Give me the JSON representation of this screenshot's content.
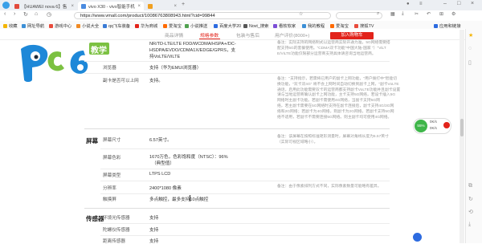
{
  "tabs": [
    {
      "title": "【HUAWEI nova 6】售",
      "active": false,
      "color": "#e24a3b"
    },
    {
      "title": "vivo X30 - vivo智能手机",
      "active": true,
      "color": "#4a8be0"
    },
    {
      "title": "",
      "active": false,
      "color": "#f0a020"
    }
  ],
  "address": {
    "url": "https://www.vmall.com/product/10086763808943.html?cid=99844"
  },
  "bookmarks": [
    {
      "label": "收藏",
      "color": "#f3b400"
    },
    {
      "label": "网址导航",
      "color": "#3c8fd6"
    },
    {
      "label": "游戏中心",
      "color": "#e94b3c"
    },
    {
      "label": "小说大全",
      "color": "#f08a24"
    },
    {
      "label": "qq飞车装备",
      "color": "#3a7bd5"
    },
    {
      "label": "华为商城",
      "color": "#e2231a"
    },
    {
      "label": "爱淘宝",
      "color": "#ff6a00"
    },
    {
      "label": "小说推送",
      "color": "#50a14f"
    },
    {
      "label": "百度大学20",
      "color": "#2d6be0"
    },
    {
      "label": "Novt_搜索",
      "color": "#555555"
    },
    {
      "label": "看软软家",
      "color": "#7b4dd6"
    },
    {
      "label": "我的教程",
      "color": "#3c8fd6"
    },
    {
      "label": "爱淘宝",
      "color": "#ff6a00"
    },
    {
      "label": "搜狐TV",
      "color": "#e94b3c"
    },
    {
      "label": "应用和链接",
      "color": "#2d6be0"
    }
  ],
  "page_nav": {
    "tabs": [
      "商品详情",
      "规格参数",
      "包装与售后",
      "用户评价(8000+)"
    ],
    "active": "规格参数",
    "add_button": "加入购物车"
  },
  "logo": {
    "brand": "pc6",
    "tag": "教学"
  },
  "network": {
    "lines": [
      "NR/TD-LTE/LTE FDD/WCDMA/HSPA+/DC-",
      "HSDPA/EVDO/CDMA1X/EDGE/GPRS，支",
      "持VoLTE/ViLTE"
    ],
    "note_lines": [
      "备注：实际支持的网络制式以运营商实际开通为准，5G网络需要搭",
      "配支持5G的套餐使用。\"CDMA双卡功能\"中国大陆-国家 \"）\"ViLT",
      "E/ViLTE功能仅限部分运营商支持具体请咨询当地运营商。"
    ]
  },
  "rows": [
    {
      "label": "浏览器",
      "value": "支持（华为EMUI浏览器）"
    },
    {
      "label": "副卡是否可以上网",
      "value": "支持。",
      "note_lines": [
        "备注：\"支持指示，若需将已用户的副卡上网功能，\"用户拨打中\"智能切",
        "换功能，\"双卡双4G\" 将不会上网时间自动切换到副卡上网，\"副卡VoLTE",
        "通话，启用此功能需要双卡的运营商都支持副卡VoLTE功能并且副卡设置",
        "请与当地运营商确认副卡上网功能，主卡支持5G网络，若设卡插入5G",
        "网络时主副卡功能。若副卡需使用4G网络，当副卡支持5G网",
        "络，若主副卡需要在5G网络时支持在副卡连接后，副卡支持4G/3G网",
        "络和2G网络；若副卡为4G网络，则副卡为2G网络，若副卡支持5G网",
        "络不适用，若副卡不需要连接5G网络。则主副卡均可使用4G网络。"
      ]
    }
  ],
  "screen": {
    "heading": "屏幕",
    "size_label": "屏幕尺寸",
    "size_value": "6.57英寸。",
    "size_note_lines": [
      "备注：该屏幕在按照标准矩形测量时，屏幕对角线长度为6.57英寸",
      "（实际可视区域略小）。"
    ],
    "color_label": "屏幕色彩",
    "color_value_lines": [
      "1670万色，色彩饱和度（NTSC）：96%",
      "（典型值）"
    ],
    "type_label": "屏幕类型",
    "type_value": "LTPS LCD",
    "res_label": "分辨率",
    "res_value": "2400*1080 像素",
    "res_note": "备注：由于像素排列方式不同，实际像素数量可能略有差异。",
    "touch_label": "触摸屏",
    "touch_value": "多点触控，最多支持10点触控"
  },
  "sensor": {
    "heading": "传感器",
    "items": [
      {
        "label": "环境光传感器",
        "value": "支持"
      },
      {
        "label": "陀螺仪传感器",
        "value": "支持"
      },
      {
        "label": "距离传感器",
        "value": "支持"
      }
    ]
  },
  "widget": {
    "percent": "55%",
    "up": "0K/s",
    "down": "0K/s"
  },
  "colors": {
    "accent": "#e2231a",
    "logo_blue": "#1e88d8",
    "logo_green": "#7cc142"
  }
}
